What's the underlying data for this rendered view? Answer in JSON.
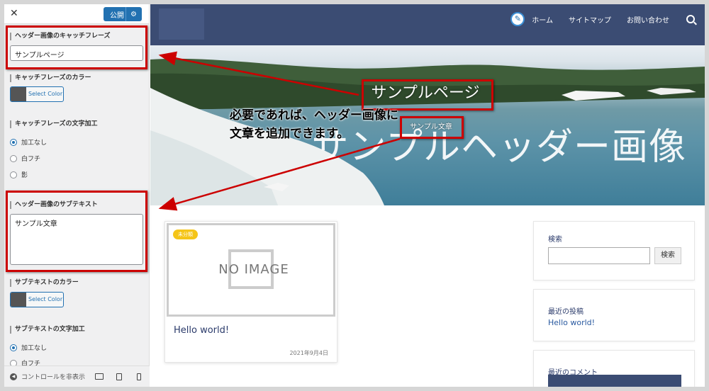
{
  "panel": {
    "close_label": "✕",
    "publish_label": "公開",
    "section1_label": "ヘッダー画像のキャッチフレーズ",
    "catch_value": "サンプルページ",
    "catch_color_label": "キャッチフレーズのカラー",
    "select_color": "Select Color",
    "catch_style_label": "キャッチフレーズの文字加工",
    "radio_options": [
      "加工なし",
      "白フチ",
      "影"
    ],
    "subtext_label": "ヘッダー画像のサブテキスト",
    "subtext_value": "サンプル文章",
    "subtext_color_label": "サブテキストのカラー",
    "subtext_style_label": "サブテキストの文字加工",
    "subtext_radio": [
      "加工なし",
      "白フチ"
    ],
    "hide_controls": "コントロールを非表示"
  },
  "nav": {
    "items": [
      "ホーム",
      "サイトマップ",
      "お問い合わせ"
    ]
  },
  "hero": {
    "catchphrase": "サンプルページ",
    "subtext": "サンプル文章",
    "title": "サンプルヘッダー画像"
  },
  "callout": {
    "line1": "必要であれば、ヘッダー画像に",
    "line2": "文章を追加できます。"
  },
  "post": {
    "category": "未分類",
    "no_image": "NO IMAGE",
    "title": "Hello world!",
    "date": "2021年9月4日"
  },
  "widgets": {
    "search_title": "検索",
    "search_button": "検索",
    "recent_posts_title": "最近の投稿",
    "recent_post": "Hello world!",
    "recent_comments_title": "最近のコメント"
  },
  "colors": {
    "header_bg": "#3b4c73",
    "accent_blue": "#2271b1",
    "highlight_red": "#cc0000",
    "badge_yellow": "#f5c518"
  }
}
